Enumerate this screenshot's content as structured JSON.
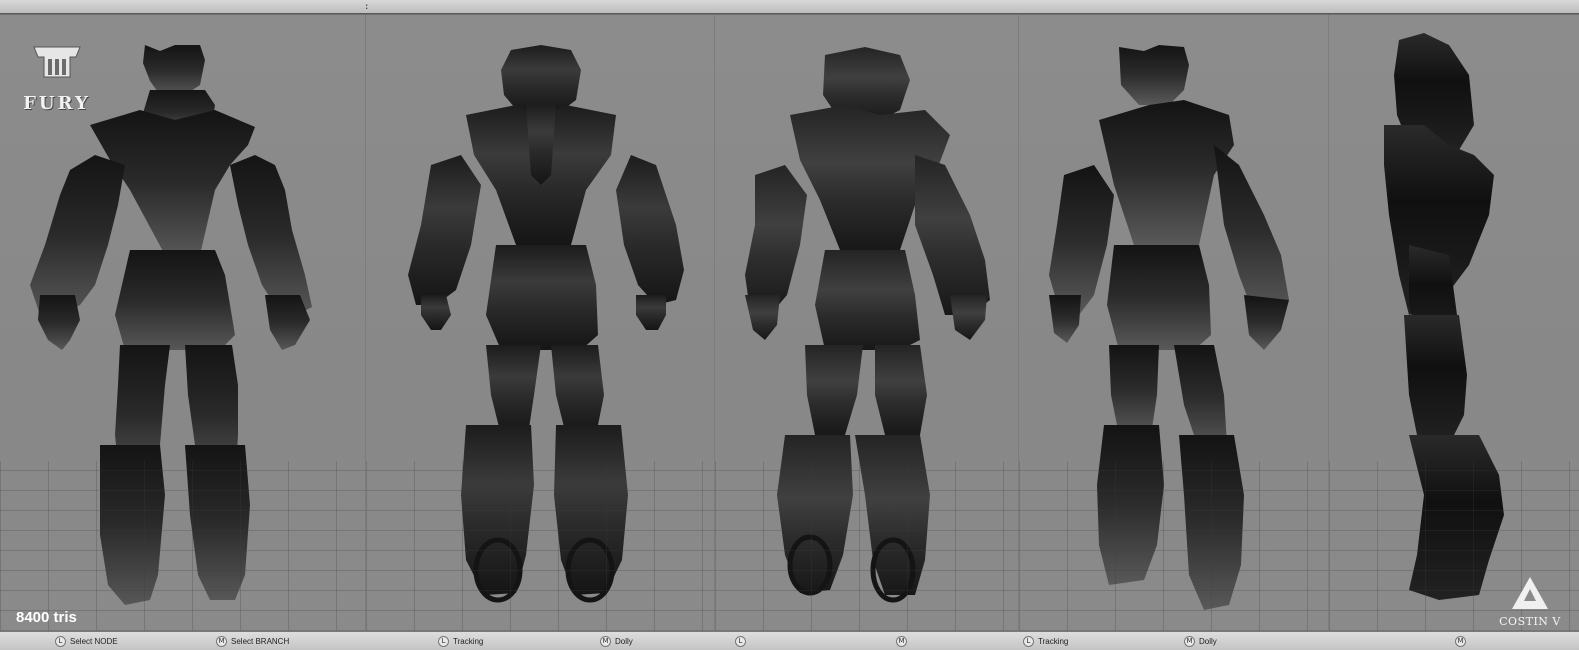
{
  "topbar": {
    "grip": ":"
  },
  "overlay": {
    "logo_text": "FURY",
    "tri_count": "8400 tris",
    "watermark": "COSTIN V"
  },
  "statusbar": {
    "items": [
      {
        "key": "L",
        "label": "Select NODE"
      },
      {
        "key": "M",
        "label": "Select BRANCH"
      },
      {
        "key": "L",
        "label": "Tracking"
      },
      {
        "key": "M",
        "label": "Dolly"
      },
      {
        "key": "L",
        "label": ""
      },
      {
        "key": "M",
        "label": ""
      },
      {
        "key": "L",
        "label": "Tracking"
      },
      {
        "key": "M",
        "label": "Dolly"
      },
      {
        "key": "M",
        "label": ""
      }
    ]
  },
  "viewports": [
    {
      "view": "front"
    },
    {
      "view": "back"
    },
    {
      "view": "back three-quarter"
    },
    {
      "view": "front three-quarter"
    },
    {
      "view": "side"
    }
  ],
  "colors": {
    "background": "#8a8a8a",
    "model": "#1c1c1c",
    "statusbar": "#d0d0d0"
  }
}
